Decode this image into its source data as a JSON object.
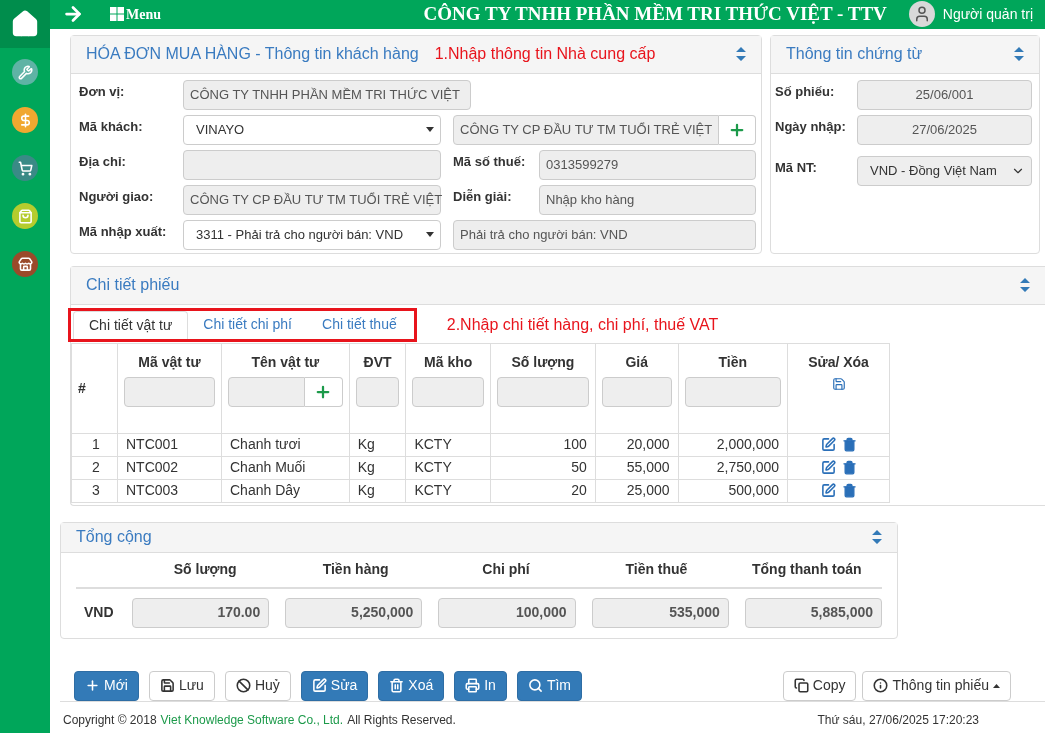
{
  "header": {
    "menu_label": "Menu",
    "company": "CÔNG TY TNHH PHẦN MỀM TRI THỨC VIỆT - TTV",
    "user": "Người quản trị"
  },
  "sidebar": [
    {
      "kind": "home",
      "selected": true
    },
    {
      "kind": "tools",
      "selected": false
    },
    {
      "kind": "money",
      "selected": false
    },
    {
      "kind": "cart",
      "selected": false
    },
    {
      "kind": "bag",
      "selected": false
    },
    {
      "kind": "store",
      "selected": false
    }
  ],
  "customer": {
    "title": "HÓA ĐƠN MUA HÀNG - Thông tin khách hàng",
    "note": "1.Nhập thông tin Nhà cung cấp",
    "rows": [
      {
        "label": "Đơn vị:",
        "kind": "readonly_short",
        "value": "CÔNG TY TNHH PHẦN MỀM TRI THỨC VIỆT"
      },
      {
        "label": "Mã khách:",
        "kind": "select",
        "value": "VINAYO",
        "right": {
          "kind": "add",
          "value": "CÔNG TY CP ĐẦU TƯ TM TUỔI TRẺ VIỆT"
        }
      },
      {
        "label": "Địa chỉ:",
        "kind": "readonly",
        "right": {
          "kind": "readonly",
          "label": "Mã số thuế:",
          "value": "0313599279"
        }
      },
      {
        "label": "Người giao:",
        "kind": "readonly",
        "value": "CÔNG TY CP ĐẦU TƯ TM TUỔI TRẺ VIỆT",
        "right": {
          "kind": "readonly",
          "label": "Diễn giải:",
          "value": "Nhập kho hàng"
        }
      },
      {
        "label": "Mã nhập xuất:",
        "kind": "select",
        "value": "3311 - Phải trả cho người bán: VND",
        "right": {
          "kind": "readonly",
          "value": "Phải trả cho người bán: VND"
        }
      }
    ]
  },
  "voucher": {
    "title": "Thông tin chứng từ",
    "fields": [
      {
        "label": "Số phiếu:",
        "kind": "readonly",
        "value": "25/06/001"
      },
      {
        "label": "Ngày nhập:",
        "kind": "readonly",
        "value": "27/06/2025"
      },
      {
        "label": "Mã NT:",
        "kind": "select",
        "value": "VND - Đồng Việt Nam"
      }
    ]
  },
  "detail": {
    "title": "Chi tiết phiếu",
    "tabs": [
      {
        "label": "Chi tiết vật tư",
        "selected": true
      },
      {
        "label": "Chi tiết chi phí",
        "selected": false
      },
      {
        "label": "Chi tiết thuế",
        "selected": false
      }
    ],
    "note": "2.Nhập chi tiết hàng, chi phí, thuế VAT",
    "columns": [
      {
        "label": "#",
        "kind": "index"
      },
      {
        "label": "Mã vật tư",
        "kind": "text"
      },
      {
        "label": "Tên vật tư",
        "kind": "lookup"
      },
      {
        "label": "ĐVT",
        "kind": "text"
      },
      {
        "label": "Mã kho",
        "kind": "text"
      },
      {
        "label": "Số lượng",
        "kind": "number"
      },
      {
        "label": "Giá",
        "kind": "number"
      },
      {
        "label": "Tiền",
        "kind": "number"
      },
      {
        "label": "Sửa/ Xóa",
        "kind": "actions"
      }
    ],
    "rows": [
      [
        "1",
        "NTC001",
        "Chanh tươi",
        "Kg",
        "KCTY",
        "100",
        "20,000",
        "2,000,000"
      ],
      [
        "2",
        "NTC002",
        "Chanh Muối",
        "Kg",
        "KCTY",
        "50",
        "55,000",
        "2,750,000"
      ],
      [
        "3",
        "NTC003",
        "Chanh Dây",
        "Kg",
        "KCTY",
        "20",
        "25,000",
        "500,000"
      ]
    ]
  },
  "totals": {
    "title": "Tổng cộng",
    "columns": [
      "Số lượng",
      "Tiền hàng",
      "Chi phí",
      "Tiền thuế",
      "Tổng thanh toán"
    ],
    "row_label": "VND",
    "values": [
      "170.00",
      "5,250,000",
      "100,000",
      "535,000",
      "5,885,000"
    ]
  },
  "buttons": [
    {
      "label": "Mới",
      "kind": "new"
    },
    {
      "label": "Lưu",
      "kind": "save"
    },
    {
      "label": "Huỷ",
      "kind": "cancel"
    },
    {
      "label": "Sửa",
      "kind": "edit"
    },
    {
      "label": "Xoá",
      "kind": "delete"
    },
    {
      "label": "In",
      "kind": "print"
    },
    {
      "label": "Tìm",
      "kind": "search"
    }
  ],
  "right_buttons": [
    {
      "label": "Copy",
      "kind": "copy"
    },
    {
      "label": "Thông tin phiếu",
      "kind": "info"
    }
  ],
  "footer": {
    "copyright": "Copyright © 2018",
    "company_link": "Viet Knowledge Software Co., Ltd.",
    "rights": "All Rights Reserved.",
    "datetime": "Thứ sáu, 27/06/2025 17:20:23"
  }
}
